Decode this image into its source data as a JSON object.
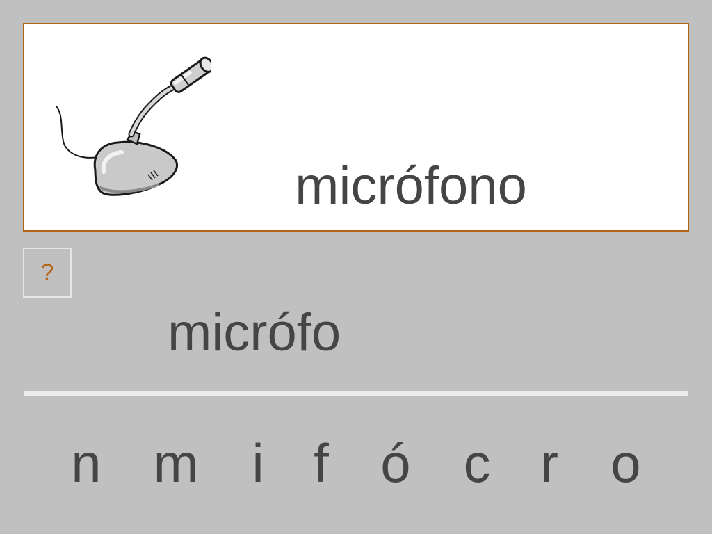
{
  "card": {
    "picture_icon": "microphone-icon",
    "word": "micrófono"
  },
  "hint": {
    "label": "?"
  },
  "answer": {
    "text": "micrófo"
  },
  "letters": [
    "n",
    "m",
    "i",
    "f",
    "ó",
    "c",
    "r",
    "o"
  ],
  "colors": {
    "background": "#c0c0c0",
    "card_border": "#b46416",
    "text": "#454545",
    "hint_text": "#b46416",
    "divider": "#ececec"
  }
}
